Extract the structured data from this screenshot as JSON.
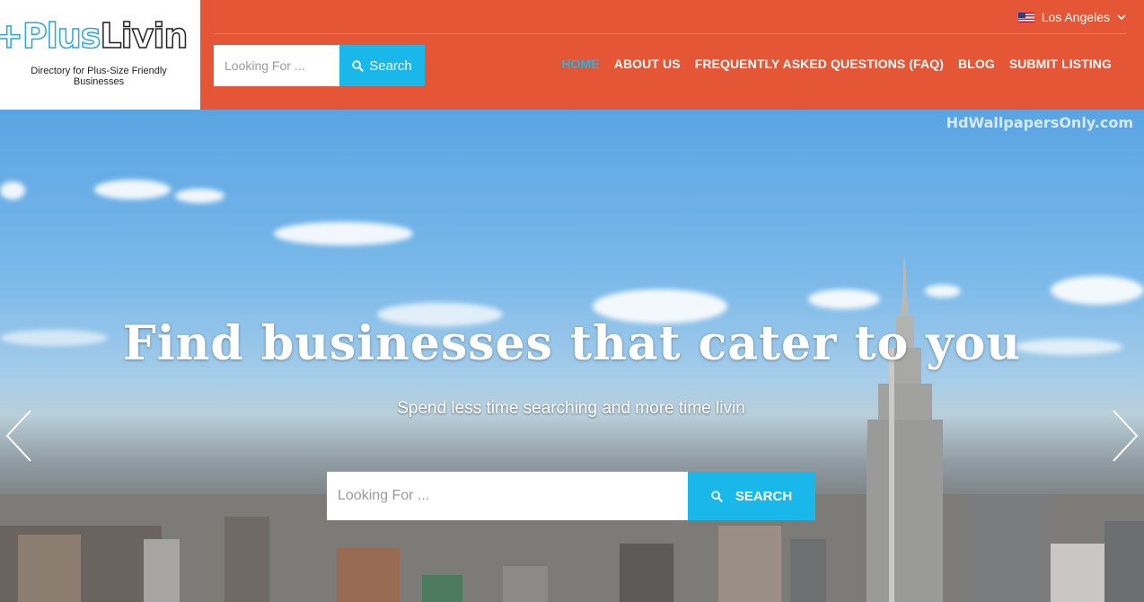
{
  "logo": {
    "plus": "+Plus",
    "livin": "Livin",
    "tagline": "Directory for Plus-Size Friendly Businesses"
  },
  "top_search": {
    "placeholder": "Looking For ...",
    "button": "Search"
  },
  "locale": {
    "label": "Los Angeles",
    "flag": "us-flag-icon"
  },
  "nav": {
    "items": [
      {
        "label": "HOME",
        "active": true
      },
      {
        "label": "ABOUT US"
      },
      {
        "label": "FREQUENTLY ASKED QUESTIONS (FAQ)"
      },
      {
        "label": "BLOG"
      },
      {
        "label": "SUBMIT LISTING"
      }
    ]
  },
  "hero": {
    "watermark": "HdWallpapersOnly.com",
    "title": "Find businesses that cater to you",
    "subtitle": "Spend less time searching and more time livin",
    "search_placeholder": "Looking For ...",
    "search_button": "SEARCH"
  },
  "colors": {
    "header": "#e45635",
    "accent": "#1ab7ea"
  }
}
